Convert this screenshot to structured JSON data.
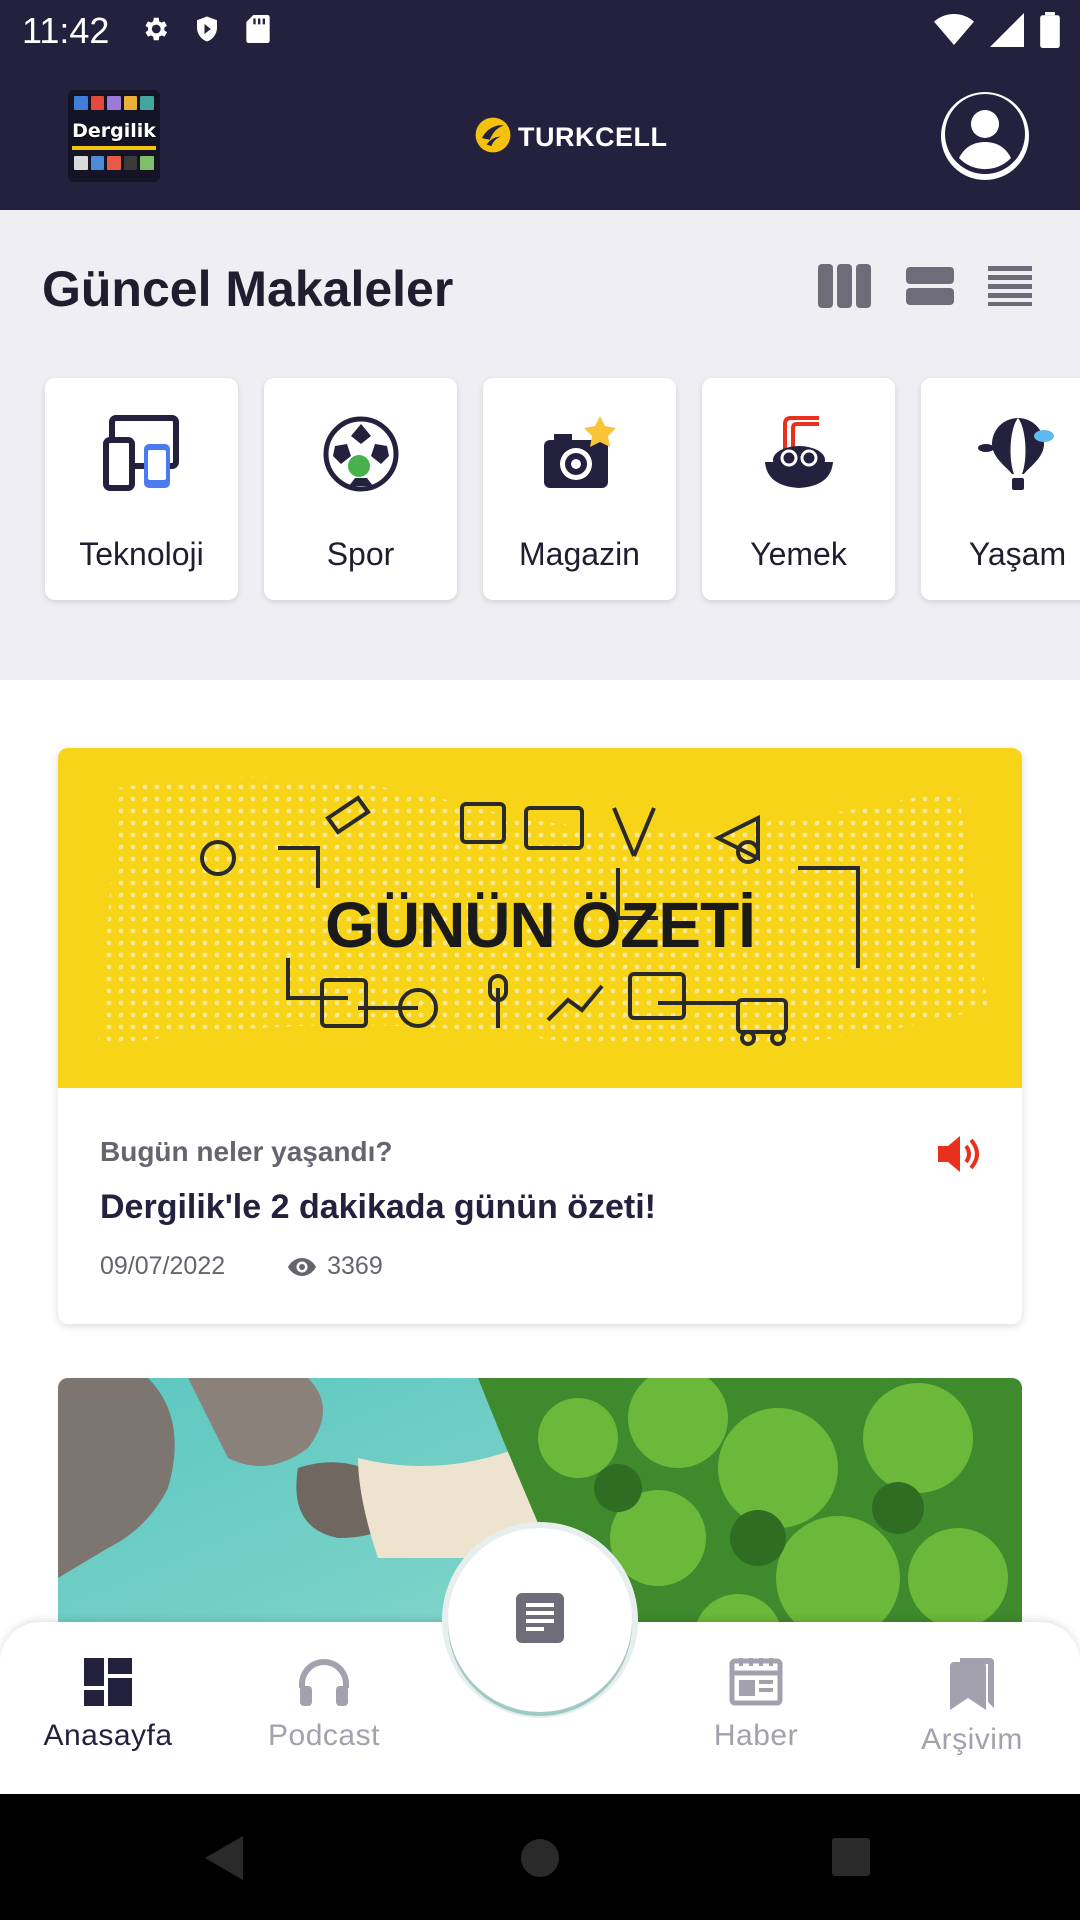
{
  "status_bar": {
    "time": "11:42",
    "left_icons": [
      "gear-icon",
      "shield-icon",
      "sdcard-icon"
    ],
    "right_icons": [
      "wifi-icon",
      "signal-icon",
      "battery-icon"
    ]
  },
  "header": {
    "logo_text": "Dergilik",
    "brand_text": "TURKCELL",
    "brand_color": "#f4c10f",
    "background": "#24213f"
  },
  "section": {
    "title": "Güncel Makaleler",
    "view_modes": [
      "grid-columns-icon",
      "list-cards-icon",
      "list-lines-icon"
    ]
  },
  "categories": [
    {
      "label": "Teknoloji",
      "icon": "devices-icon"
    },
    {
      "label": "Spor",
      "icon": "soccer-ball-icon"
    },
    {
      "label": "Magazin",
      "icon": "camera-star-icon"
    },
    {
      "label": "Yemek",
      "icon": "noodle-bowl-icon"
    },
    {
      "label": "Yaşam",
      "icon": "hot-air-balloon-icon"
    }
  ],
  "articles": [
    {
      "banner_text": "GÜNÜN ÖZETİ",
      "subtitle": "Bugün neler yaşandı?",
      "headline": "Dergilik'le 2 dakikada günün özeti!",
      "date": "09/07/2022",
      "views": "3369",
      "accent": "#e8301c"
    }
  ],
  "bottom_nav": {
    "items": [
      {
        "label": "Anasayfa",
        "icon": "dashboard-icon",
        "active": true
      },
      {
        "label": "Podcast",
        "icon": "headphones-icon",
        "active": false
      },
      {
        "label": "Haber",
        "icon": "newspaper-icon",
        "active": false
      },
      {
        "label": "Arşivim",
        "icon": "bookmarks-icon",
        "active": false
      }
    ],
    "center_icon": "article-icon"
  }
}
